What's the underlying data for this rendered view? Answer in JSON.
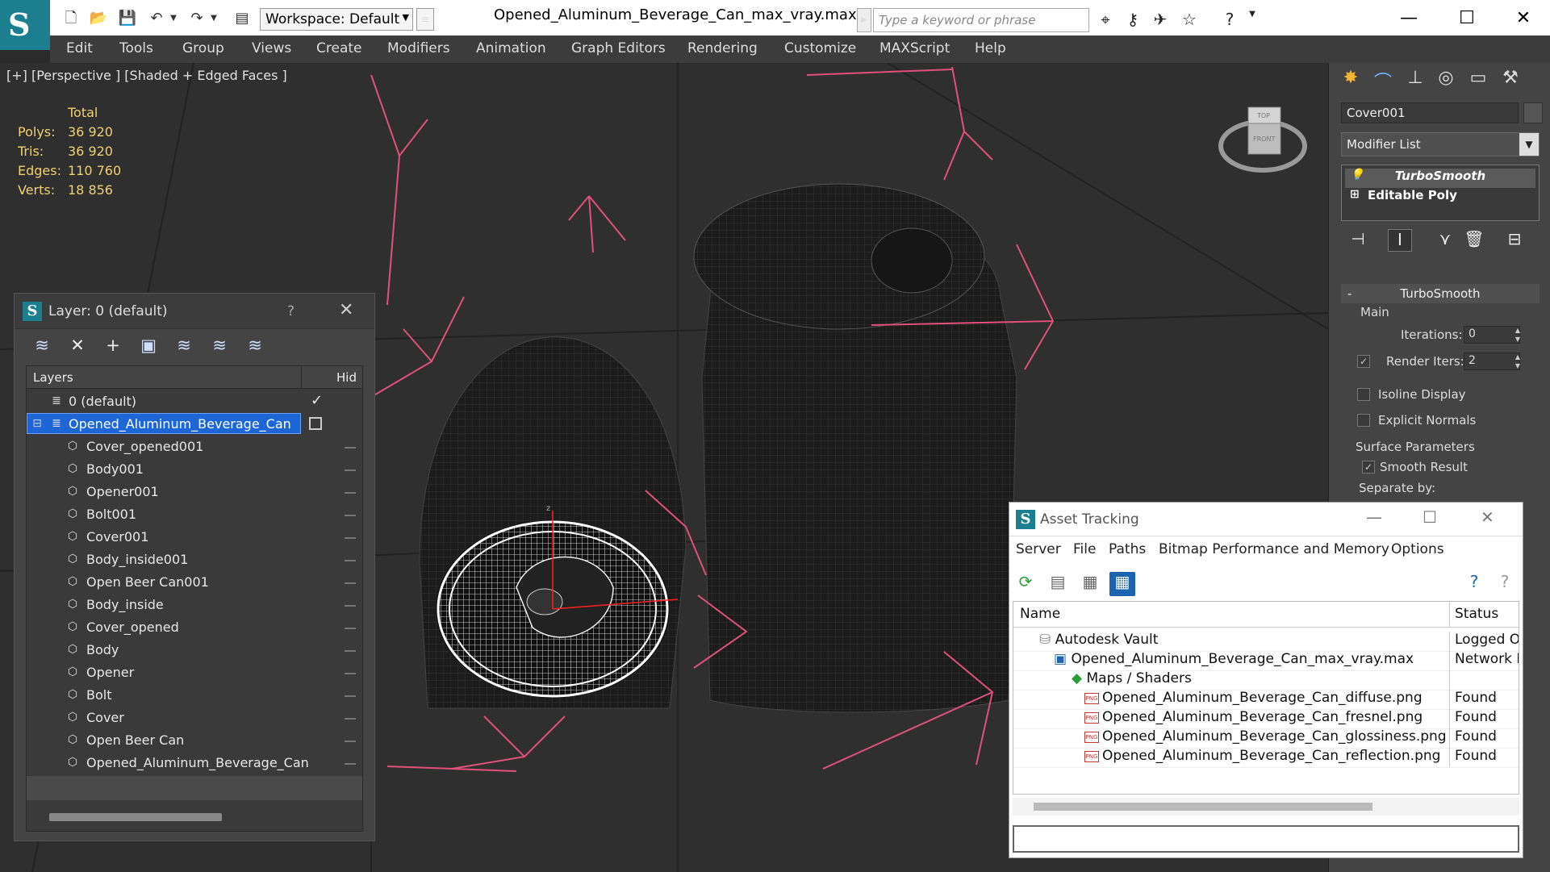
{
  "app": {
    "workspace": "Workspace: Default",
    "doc_title": "Opened_Aluminum_Beverage_Can_max_vray.max",
    "search_placeholder": "Type a keyword or phrase"
  },
  "menubar": [
    "Edit",
    "Tools",
    "Group",
    "Views",
    "Create",
    "Modifiers",
    "Animation",
    "Graph Editors",
    "Rendering",
    "Customize",
    "MAXScript",
    "Help"
  ],
  "viewport": {
    "label": "[+] [Perspective ] [Shaded + Edged Faces ]",
    "stats_header": "Total",
    "stats": [
      {
        "label": "Polys:",
        "value": "36 920"
      },
      {
        "label": "Tris:",
        "value": "36 920"
      },
      {
        "label": "Edges:",
        "value": "110 760"
      },
      {
        "label": "Verts:",
        "value": "18 856"
      }
    ],
    "viewcube_top": "TOP",
    "viewcube_front": "FRONT"
  },
  "command_panel": {
    "object_name": "Cover001",
    "modifier_list": "Modifier List",
    "stack": [
      "TurboSmooth",
      "Editable Poly"
    ],
    "rollout_title": "TurboSmooth",
    "main_label": "Main",
    "iterations_label": "Iterations:",
    "iterations_value": "0",
    "render_iters_label": "Render Iters:",
    "render_iters_value": "2",
    "isoline_label": "Isoline Display",
    "explicit_normals_label": "Explicit Normals",
    "surface_params_label": "Surface Parameters",
    "smooth_result_label": "Smooth Result",
    "separate_by_label": "Separate by:"
  },
  "layer_window": {
    "title": "Layer: 0 (default)",
    "help": "?",
    "col_layers": "Layers",
    "col_hide": "Hid",
    "rows": [
      {
        "name": "0 (default)",
        "level": 0,
        "type": "layer"
      },
      {
        "name": "Opened_Aluminum_Beverage_Can",
        "level": 0,
        "type": "layer",
        "selected": true
      },
      {
        "name": "Cover_opened001",
        "level": 1,
        "type": "object"
      },
      {
        "name": "Body001",
        "level": 1,
        "type": "object"
      },
      {
        "name": "Opener001",
        "level": 1,
        "type": "object"
      },
      {
        "name": "Bolt001",
        "level": 1,
        "type": "object"
      },
      {
        "name": "Cover001",
        "level": 1,
        "type": "object"
      },
      {
        "name": "Body_inside001",
        "level": 1,
        "type": "object"
      },
      {
        "name": "Open Beer Can001",
        "level": 1,
        "type": "object"
      },
      {
        "name": "Body_inside",
        "level": 1,
        "type": "object"
      },
      {
        "name": "Cover_opened",
        "level": 1,
        "type": "object"
      },
      {
        "name": "Body",
        "level": 1,
        "type": "object"
      },
      {
        "name": "Opener",
        "level": 1,
        "type": "object"
      },
      {
        "name": "Bolt",
        "level": 1,
        "type": "object"
      },
      {
        "name": "Cover",
        "level": 1,
        "type": "object"
      },
      {
        "name": "Open Beer Can",
        "level": 1,
        "type": "object"
      },
      {
        "name": "Opened_Aluminum_Beverage_Can",
        "level": 1,
        "type": "object"
      }
    ]
  },
  "asset_window": {
    "title": "Asset Tracking",
    "menu": [
      "Server",
      "File",
      "Paths",
      "Bitmap Performance and Memory",
      "Options"
    ],
    "col_name": "Name",
    "col_status": "Status",
    "rows": [
      {
        "name": "Autodesk Vault",
        "status": "Logged O",
        "indent": 1,
        "icon": "vault"
      },
      {
        "name": "Opened_Aluminum_Beverage_Can_max_vray.max",
        "status": "Network F",
        "indent": 2,
        "icon": "max"
      },
      {
        "name": "Maps / Shaders",
        "status": "",
        "indent": 3,
        "icon": "maps"
      },
      {
        "name": "Opened_Aluminum_Beverage_Can_diffuse.png",
        "status": "Found",
        "indent": 4,
        "icon": "png"
      },
      {
        "name": "Opened_Aluminum_Beverage_Can_fresnel.png",
        "status": "Found",
        "indent": 4,
        "icon": "png"
      },
      {
        "name": "Opened_Aluminum_Beverage_Can_glossiness.png",
        "status": "Found",
        "indent": 4,
        "icon": "png"
      },
      {
        "name": "Opened_Aluminum_Beverage_Can_reflection.png",
        "status": "Found",
        "indent": 4,
        "icon": "png"
      }
    ]
  },
  "colors": {
    "selection": "#1e66d6",
    "stats": "#f0d070",
    "gizmo": "#e0507a",
    "app_teal": "#1b7f8f"
  }
}
